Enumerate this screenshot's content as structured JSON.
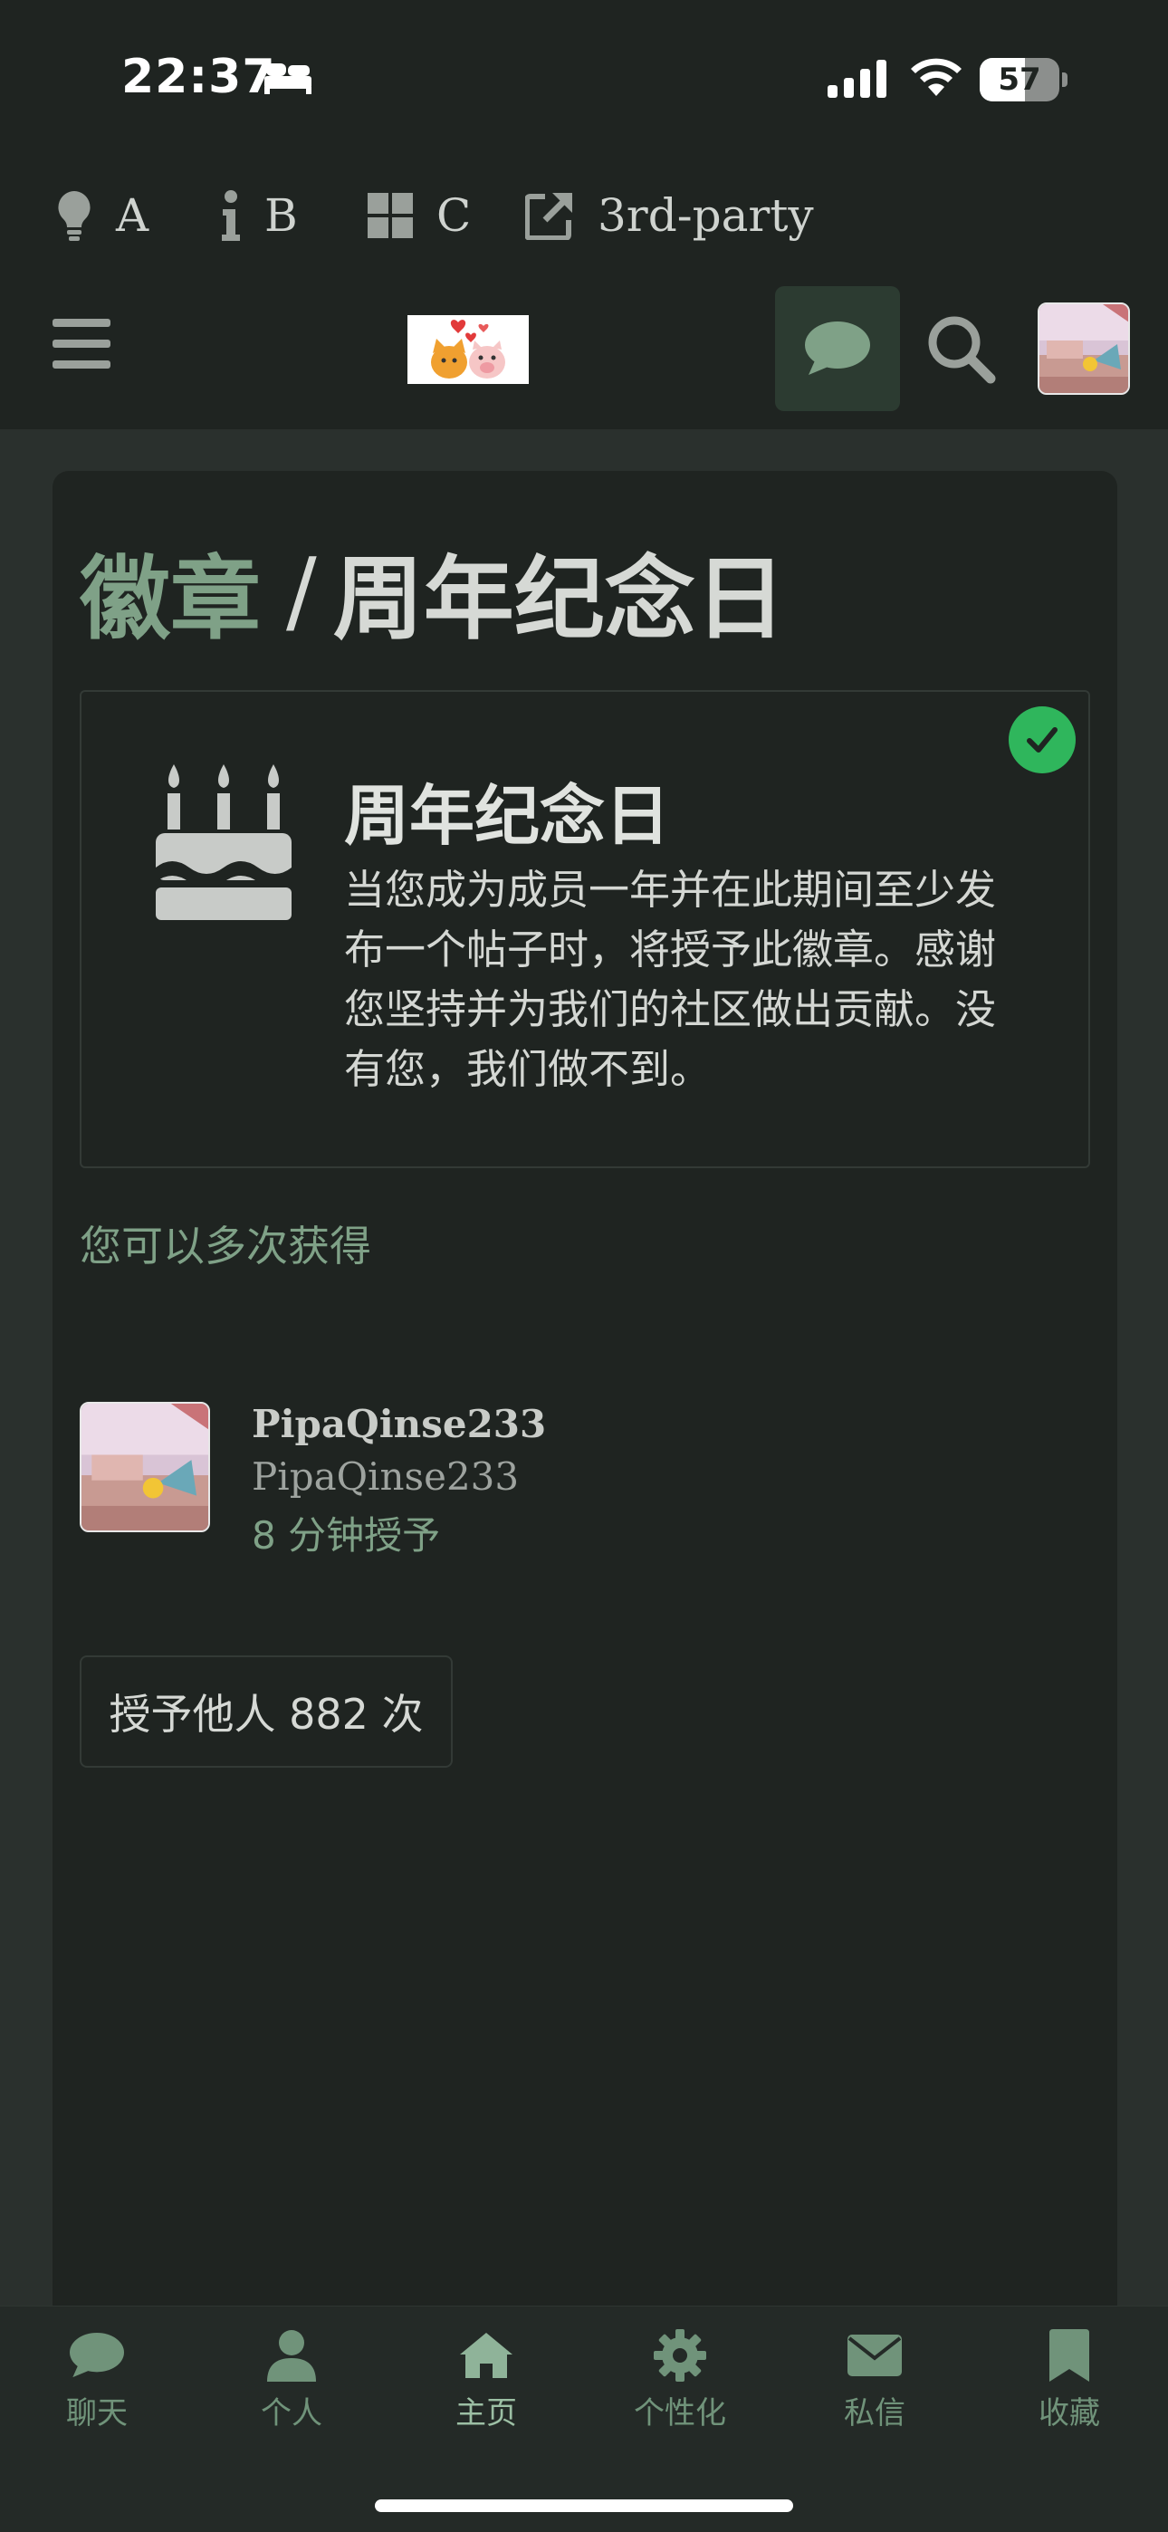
{
  "status_bar": {
    "time": "22:37",
    "battery": "57",
    "battery_level": 0.57,
    "icons": [
      "bed-icon",
      "signal-icon",
      "wifi-icon",
      "battery-icon"
    ]
  },
  "link_bar": {
    "items": [
      {
        "label": "A",
        "icon": "lightbulb-icon"
      },
      {
        "label": "B",
        "icon": "info-icon"
      },
      {
        "label": "C",
        "icon": "windows-icon"
      },
      {
        "label": "3rd-party",
        "icon": "external-link-icon"
      }
    ]
  },
  "header": {
    "icons": [
      "menu-icon",
      "chat-icon",
      "search-icon"
    ]
  },
  "page": {
    "breadcrumb": {
      "parent": "徽章",
      "separator": "/",
      "current": "周年纪念日"
    },
    "badge": {
      "title": "周年纪念日",
      "description": "当您成为成员一年并在此期间至少发布一个帖子时，将授予此徽章。感谢您坚持并为我们的社区做出贡献。没有您，我们做不到。",
      "icon": "birthday-cake-icon",
      "status_icon": "check-icon"
    },
    "multi_grant_note": "您可以多次获得",
    "granted_user": {
      "name": "PipaQinse233",
      "handle": "PipaQinse233",
      "granted_time": "8 分钟授予"
    },
    "granted_count": "授予他人 882 次"
  },
  "bottom_nav": {
    "items": [
      {
        "label": "聊天",
        "icon": "chat-icon"
      },
      {
        "label": "个人",
        "icon": "user-icon"
      },
      {
        "label": "主页",
        "icon": "home-icon"
      },
      {
        "label": "个性化",
        "icon": "gear-icon"
      },
      {
        "label": "私信",
        "icon": "envelope-icon"
      },
      {
        "label": "收藏",
        "icon": "bookmark-icon"
      }
    ]
  },
  "colors": {
    "background": "#1f2421",
    "accent_green": "#7fa187",
    "check_green": "#2fb65c"
  }
}
